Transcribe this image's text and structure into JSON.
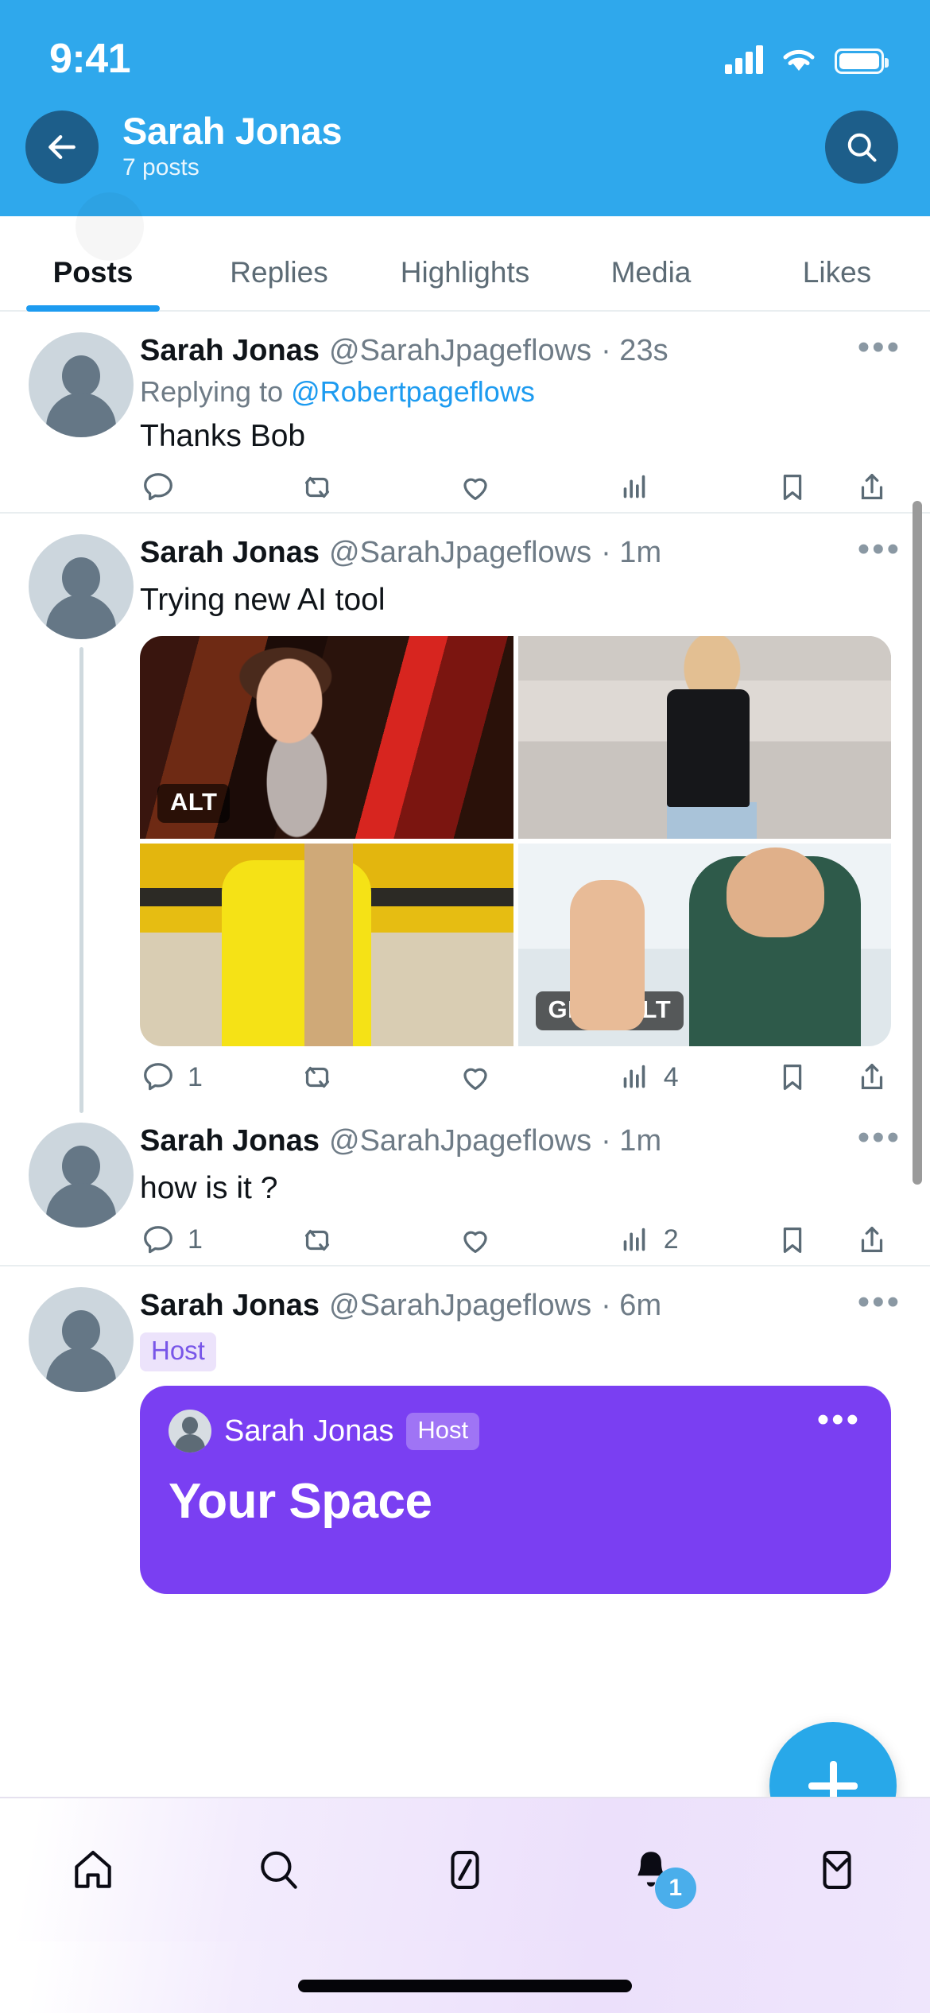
{
  "status_bar": {
    "time": "9:41",
    "signal_icon": "cellular-signal-icon",
    "wifi_icon": "wifi-icon",
    "battery_icon": "battery-icon"
  },
  "header": {
    "back_icon": "back-arrow-icon",
    "title": "Sarah Jonas",
    "subtitle": "7 posts",
    "search_icon": "search-icon",
    "bg_color": "#2fa8ec",
    "button_color": "#1d5e8a"
  },
  "tabs": [
    {
      "label": "Posts",
      "active": true
    },
    {
      "label": "Replies",
      "active": false
    },
    {
      "label": "Highlights",
      "active": false
    },
    {
      "label": "Media",
      "active": false
    },
    {
      "label": "Likes",
      "active": false
    }
  ],
  "accent_color": "#1d9bf0",
  "tweets": [
    {
      "name": "Sarah Jonas",
      "handle": "@SarahJpageflows",
      "time": "· 23s",
      "replying_prefix": "Replying to ",
      "replying_to": "@Robertpageflows",
      "text": "Thanks Bob",
      "actions": {
        "reply": "",
        "retweet": "",
        "like": "",
        "views": "",
        "bookmark": "",
        "share": ""
      }
    },
    {
      "name": "Sarah Jonas",
      "handle": "@SarahJpageflows",
      "time": "· 1m",
      "text": "Trying new AI tool",
      "media": [
        {
          "badges": [
            "ALT"
          ]
        },
        {
          "badges": []
        },
        {
          "badges": []
        },
        {
          "badges": [
            "GIF",
            "ALT"
          ]
        }
      ],
      "actions": {
        "reply": "1",
        "retweet": "",
        "like": "",
        "views": "4",
        "bookmark": "",
        "share": ""
      }
    },
    {
      "name": "Sarah Jonas",
      "handle": "@SarahJpageflows",
      "time": "· 1m",
      "text": "how is it ?",
      "actions": {
        "reply": "1",
        "retweet": "",
        "like": "",
        "views": "2",
        "bookmark": "",
        "share": ""
      }
    },
    {
      "name": "Sarah Jonas",
      "handle": "@SarahJpageflows",
      "time": "· 6m",
      "badge": "Host",
      "space_card": {
        "host_name": "Sarah Jonas",
        "host_badge": "Host",
        "title": "Your Space",
        "menu_icon": "more-options-icon",
        "bg_color": "#7a3ff2"
      }
    }
  ],
  "fab": {
    "icon": "plus-icon",
    "color": "#28a8e9"
  },
  "bottom_nav": [
    {
      "name": "home",
      "icon": "home-icon",
      "badge": ""
    },
    {
      "name": "search",
      "icon": "search-icon",
      "badge": ""
    },
    {
      "name": "grok",
      "icon": "grok-slash-icon",
      "badge": ""
    },
    {
      "name": "notifications",
      "icon": "bell-icon",
      "badge": "1"
    },
    {
      "name": "messages",
      "icon": "mail-icon",
      "badge": ""
    }
  ],
  "badge_color": "#4aaeeb"
}
